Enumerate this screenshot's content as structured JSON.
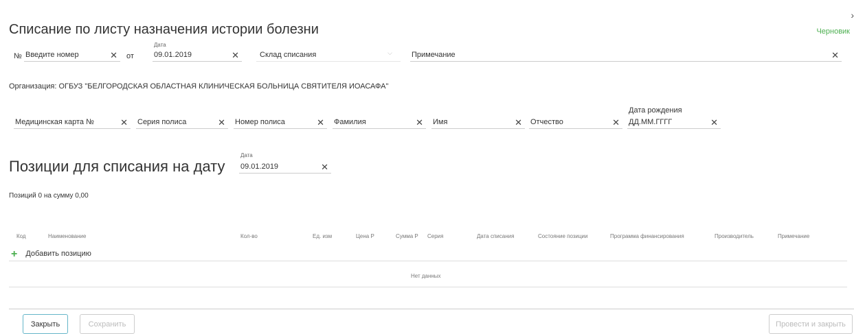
{
  "header": {
    "title": "Списание по листу назначения истории болезни",
    "status": "Черновик",
    "close_glyph": "›"
  },
  "doc": {
    "number_prefix": "№",
    "number_placeholder": "Введите номер",
    "from_label": "от",
    "date_label": "Дата",
    "date_value": "09.01.2019",
    "warehouse_placeholder": "Склад списания",
    "note_placeholder": "Примечание"
  },
  "organization": "Организация: ОГБУЗ \"БЕЛГОРОДСКАЯ ОБЛАСТНАЯ КЛИНИЧЕСКАЯ БОЛЬНИЦА СВЯТИТЕЛЯ ИОАСАФА\"",
  "patient": {
    "card_placeholder": "Медицинская карта №",
    "policy_series_placeholder": "Серия полиса",
    "policy_number_placeholder": "Номер полиса",
    "lastname_placeholder": "Фамилия",
    "firstname_placeholder": "Имя",
    "patronymic_placeholder": "Отчество",
    "birthdate_label": "Дата рождения",
    "birthdate_placeholder": "ДД.ММ.ГГГГ"
  },
  "positions": {
    "title": "Позиции для списания на дату",
    "date_label": "Дата",
    "date_value": "09.01.2019",
    "summary": "Позиций 0 на сумму 0,00",
    "columns": [
      "Код",
      "Наименование",
      "Кол-во",
      "Ед. изм",
      "Цена Р",
      "Сумма Р",
      "Серия",
      "Дата списания",
      "Состояние позиции",
      "Программа финансирования",
      "Производитель",
      "Примечание"
    ],
    "add_label": "Добавить позицию",
    "empty_text": "Нет данных"
  },
  "footer": {
    "close_label": "Закрыть",
    "save_label": "Сохранить",
    "post_close_label": "Провести и закрыть"
  },
  "colors": {
    "status": "#4caf50",
    "add_icon": "#4caf50",
    "primary_border": "#64b5c9"
  },
  "icons": {
    "clear": "close-icon",
    "dropdown": "chevron-down-icon",
    "add": "plus-icon"
  }
}
